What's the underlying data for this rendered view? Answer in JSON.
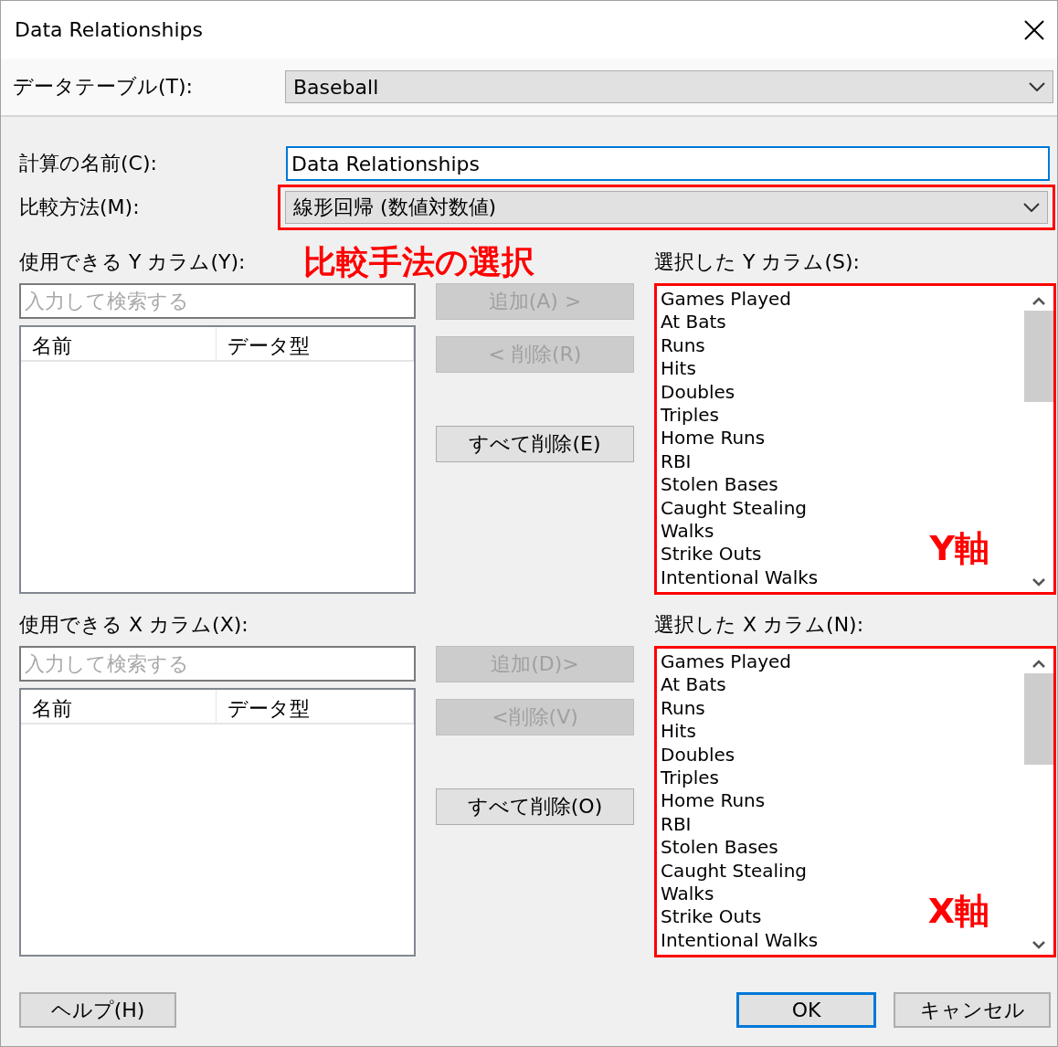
{
  "window": {
    "title": "Data Relationships"
  },
  "data_table": {
    "label": "データテーブル(T):",
    "value": "Baseball"
  },
  "calculation_name": {
    "label": "計算の名前(C):",
    "value": "Data Relationships"
  },
  "comparison_method": {
    "label": "比較方法(M):",
    "value": "線形回帰 (数値対数値)",
    "highlighted": true
  },
  "sections": [
    {
      "available_label": "使用できる Y カラム(Y):",
      "callout": "比較手法の選択",
      "search_placeholder": "入力して検索する",
      "columns": [
        "名前",
        "データ型"
      ],
      "buttons": [
        {
          "label": "追加(A) >",
          "disabled": true
        },
        {
          "label": "< 削除(R)",
          "disabled": true
        },
        {
          "label": "すべて削除(E)",
          "disabled": false
        }
      ],
      "selected_label": "選択した Y カラム(S):",
      "highlighted": true,
      "list_callout": "Y軸",
      "selected_items": [
        "Games Played",
        "At Bats",
        "Runs",
        "Hits",
        "Doubles",
        "Triples",
        "Home Runs",
        "RBI",
        "Stolen Bases",
        "Caught Stealing",
        "Walks",
        "Strike Outs",
        "Intentional Walks"
      ]
    },
    {
      "available_label": "使用できる X カラム(X):",
      "search_placeholder": "入力して検索する",
      "columns": [
        "名前",
        "データ型"
      ],
      "buttons": [
        {
          "label": "追加(D)>",
          "disabled": true
        },
        {
          "label": "<削除(V)",
          "disabled": true
        },
        {
          "label": "すべて削除(O)",
          "disabled": false
        }
      ],
      "selected_label": "選択した X カラム(N):",
      "highlighted": true,
      "list_callout": "X軸",
      "selected_items": [
        "Games Played",
        "At Bats",
        "Runs",
        "Hits",
        "Doubles",
        "Triples",
        "Home Runs",
        "RBI",
        "Stolen Bases",
        "Caught Stealing",
        "Walks",
        "Strike Outs",
        "Intentional Walks"
      ]
    }
  ],
  "footer": {
    "help": "ヘルプ(H)",
    "ok": "OK",
    "cancel": "キャンセル"
  }
}
